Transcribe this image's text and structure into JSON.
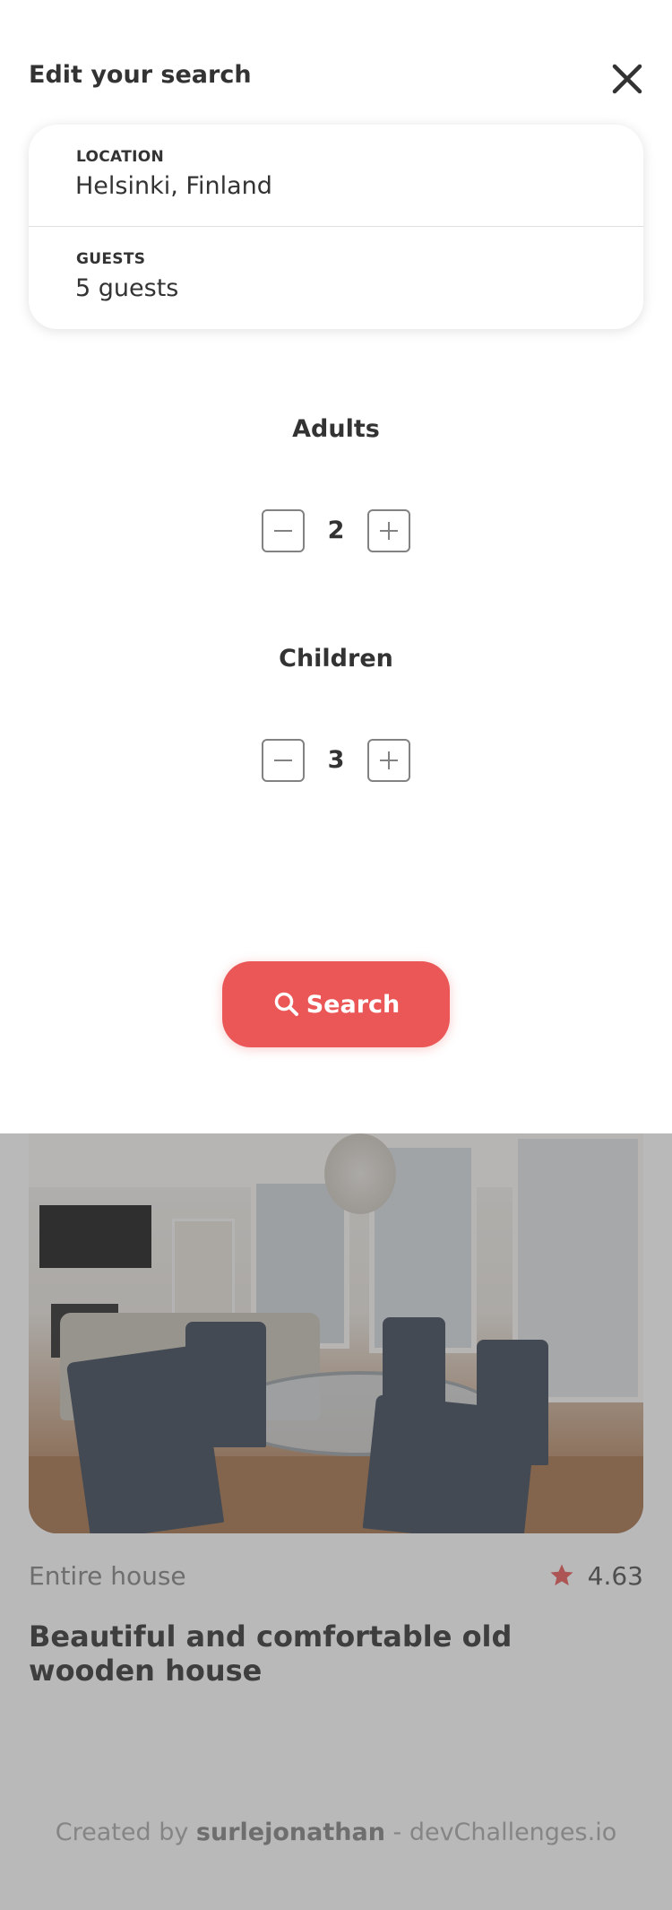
{
  "drawer": {
    "title": "Edit your search",
    "location": {
      "label": "LOCATION",
      "value": "Helsinki, Finland"
    },
    "guests": {
      "label": "GUESTS",
      "value": "5 guests"
    },
    "adults": {
      "label": "Adults",
      "count": "2"
    },
    "children": {
      "label": "Children",
      "count": "3"
    },
    "search_button": {
      "label": "Search"
    }
  },
  "listing": {
    "type": "Entire house",
    "rating": "4.63",
    "title": "Beautiful and comfortable old wooden house"
  },
  "footer": {
    "prefix": "Created by ",
    "author": "surlejonathan",
    "suffix": " - devChallenges.io"
  },
  "colors": {
    "accent": "#eb5757",
    "text": "#333333",
    "muted": "#828282",
    "overlay": "rgba(79,79,79,0.4)"
  },
  "icons": {
    "close": "close-icon",
    "minus": "minus-icon",
    "plus": "plus-icon",
    "search": "search-icon",
    "star": "star-icon"
  }
}
